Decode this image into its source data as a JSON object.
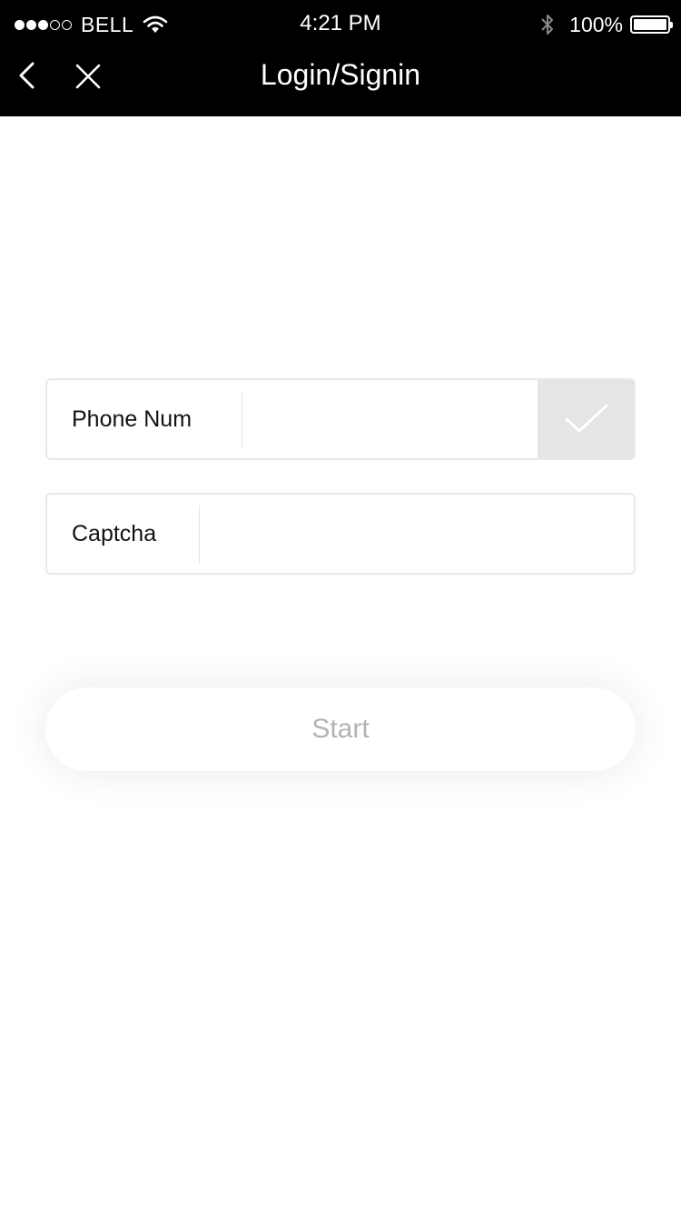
{
  "status_bar": {
    "signal_filled": 3,
    "signal_total": 5,
    "carrier": "BELL",
    "time": "4:21 PM",
    "battery_percent": "100%",
    "battery_level": 1.0
  },
  "nav": {
    "back_icon": "chevron-left-icon",
    "close_icon": "close-icon",
    "title": "Login/Signin"
  },
  "form": {
    "phone": {
      "label": "Phone Num",
      "value": "",
      "placeholder": ""
    },
    "captcha": {
      "label": "Captcha",
      "value": "",
      "placeholder": ""
    },
    "confirm_icon": "checkmark-icon"
  },
  "start_button": {
    "label": "Start"
  },
  "colors": {
    "topbar": "#000000",
    "confirm_bg": "#e5e5e5",
    "start_text": "#b3b3b3",
    "field_border": "#e9e9e9"
  }
}
